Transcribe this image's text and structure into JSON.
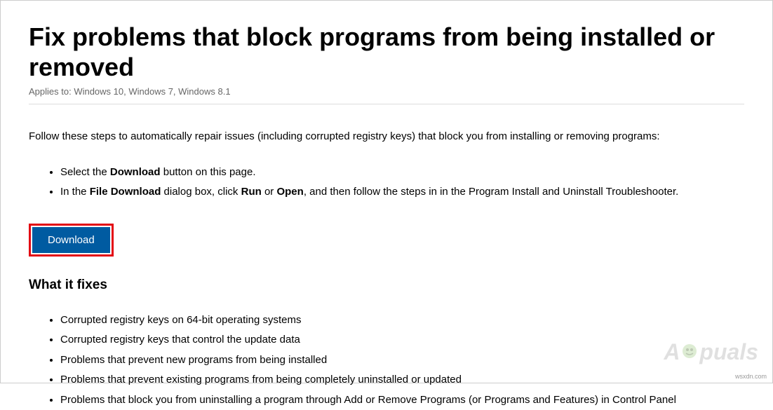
{
  "header": {
    "title": "Fix problems that block programs from being installed or removed",
    "applies_to": "Applies to: Windows 10, Windows 7, Windows 8.1"
  },
  "intro": "Follow these steps to automatically repair issues (including corrupted registry keys) that block you from installing or removing programs:",
  "steps": [
    {
      "pre": "Select the ",
      "bold1": "Download",
      "post": " button on this page."
    },
    {
      "pre": "In the ",
      "bold1": "File Download",
      "mid1": " dialog box, click ",
      "bold2": "Run",
      "mid2": " or ",
      "bold3": "Open",
      "post": ", and then follow the steps in in the Program Install and Uninstall Troubleshooter."
    }
  ],
  "button": {
    "download_label": "Download"
  },
  "section": {
    "what_it_fixes": "What it fixes"
  },
  "fixes": [
    "Corrupted registry keys on 64-bit operating systems",
    "Corrupted registry keys that control the update data",
    "Problems that prevent new programs from being installed",
    "Problems that prevent existing programs from being completely uninstalled or updated",
    "Problems that block you from uninstalling a program through Add or Remove Programs (or Programs and Features) in Control Panel"
  ],
  "watermark": "A  puals",
  "attribution": "wsxdn.com"
}
